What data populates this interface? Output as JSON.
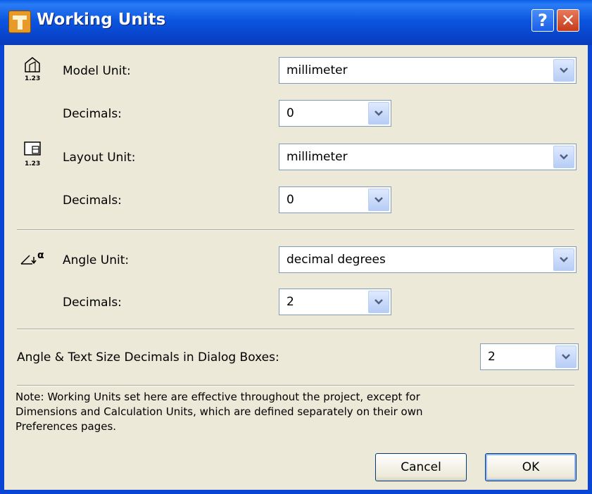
{
  "window": {
    "title": "Working Units",
    "help_label": "?",
    "close_label": "✕"
  },
  "model_unit": {
    "label": "Model Unit:",
    "value": "millimeter",
    "icon": "model-unit-icon",
    "icon_text": "1.23"
  },
  "model_decimals": {
    "label": "Decimals:",
    "value": "0"
  },
  "layout_unit": {
    "label": "Layout Unit:",
    "value": "millimeter",
    "icon": "layout-unit-icon",
    "icon_text": "1.23"
  },
  "layout_decimals": {
    "label": "Decimals:",
    "value": "0"
  },
  "angle_unit": {
    "label": "Angle Unit:",
    "value": "decimal degrees",
    "icon": "angle-unit-icon"
  },
  "angle_decimals": {
    "label": "Decimals:",
    "value": "2"
  },
  "dialog_decimals": {
    "label": "Angle & Text Size Decimals in Dialog Boxes:",
    "value": "2"
  },
  "note": "Note: Working Units set here are effective throughout the project, except for\nDimensions and Calculation Units, which are defined separately on their own\nPreferences pages.",
  "buttons": {
    "cancel": "Cancel",
    "ok": "OK"
  }
}
